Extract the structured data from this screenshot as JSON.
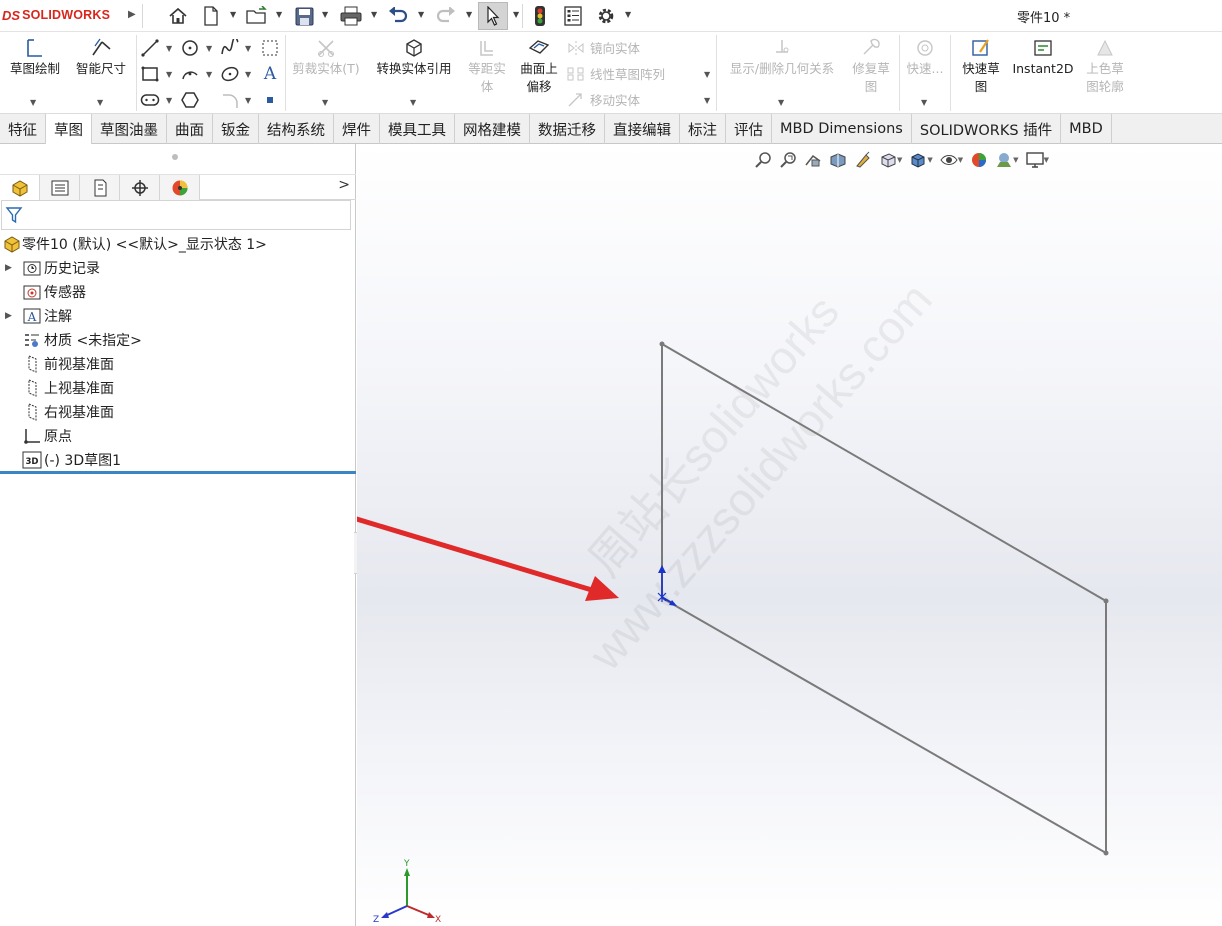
{
  "app": {
    "logo_ds": "DS",
    "logo_text": "SOLIDWORKS",
    "document_title": "零件10 *"
  },
  "command_manager": {
    "sketch": "草图绘制",
    "smart_dimension": "智能尺寸",
    "trim": "剪裁实体(T)",
    "convert": "转换实体引用",
    "offset_line1": "等距实",
    "offset_line2": "体",
    "surface_offset_line1": "曲面上",
    "surface_offset_line2": "偏移",
    "mirror": "镜向实体",
    "linear_pattern": "线性草图阵列",
    "move": "移动实体",
    "relations": "显示/删除几何关系",
    "repair_line1": "修复草",
    "repair_line2": "图",
    "quick_snaps": "快速...",
    "rapid_sketch_line1": "快速草",
    "rapid_sketch_line2": "图",
    "instant2d": "Instant2D",
    "shaded_line1": "上色草",
    "shaded_line2": "图轮廓"
  },
  "tabs": [
    "特征",
    "草图",
    "草图油墨",
    "曲面",
    "钣金",
    "结构系统",
    "焊件",
    "模具工具",
    "网格建模",
    "数据迁移",
    "直接编辑",
    "标注",
    "评估",
    "MBD Dimensions",
    "SOLIDWORKS 插件",
    "MBD"
  ],
  "active_tab": "草图",
  "tree": {
    "root": "零件10 (默认) <<默认>_显示状态 1>",
    "items": [
      "历史记录",
      "传感器",
      "注解",
      "材质 <未指定>",
      "前视基准面",
      "上视基准面",
      "右视基准面",
      "原点",
      "(-) 3D草图1"
    ]
  },
  "viewport": {
    "watermark_line1": "周站长solidworks",
    "watermark_line2": "www.zzzsolidworks.com",
    "triad": {
      "y": "Y",
      "x": "X",
      "z": "Z"
    }
  },
  "colors": {
    "brand": "#d9261c",
    "sketch_line": "#7a7a7a",
    "arrow": "#e02a2a",
    "rollback_bar": "#3a86c4",
    "origin_blue": "#1a33c8"
  }
}
